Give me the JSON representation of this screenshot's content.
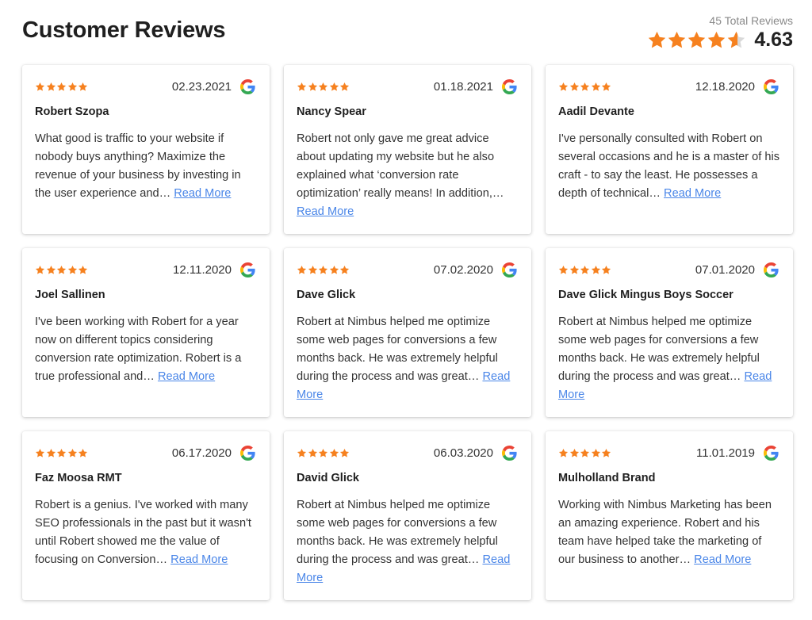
{
  "header": {
    "title": "Customer Reviews",
    "total_reviews": "45 Total Reviews",
    "rating": "4.63"
  },
  "colors": {
    "star": "#f6811f",
    "link": "#4a86e8"
  },
  "icons": {
    "star": "star-icon",
    "google": "google-icon"
  },
  "reviews": [
    {
      "date": "02.23.2021",
      "name": "Robert Szopa",
      "stars": 5,
      "text": "What good is traffic to your website if nobody buys anything? Maximize the revenue of your business by investing in the user experience and…",
      "read_more": "Read More"
    },
    {
      "date": "01.18.2021",
      "name": "Nancy Spear",
      "stars": 5,
      "text": "Robert not only gave me great advice about updating my website but he also explained what ‘conversion rate optimization’ really means! In addition,…",
      "read_more": "Read More"
    },
    {
      "date": "12.18.2020",
      "name": "Aadil Devante",
      "stars": 5,
      "text": "I've personally consulted with Robert on several occasions and he is a master of his craft - to say the least. He possesses a depth of technical…",
      "read_more": "Read More"
    },
    {
      "date": "12.11.2020",
      "name": "Joel Sallinen",
      "stars": 5,
      "text": "I've been working with Robert for a year now on different topics considering conversion rate optimization. Robert is a true professional and…",
      "read_more": "Read More"
    },
    {
      "date": "07.02.2020",
      "name": "Dave Glick",
      "stars": 5,
      "text": "Robert at Nimbus helped me optimize some web pages for conversions a few months back. He was extremely helpful during the process and was great…",
      "read_more": "Read More"
    },
    {
      "date": "07.01.2020",
      "name": "Dave Glick Mingus Boys Soccer",
      "stars": 5,
      "text": "Robert at Nimbus helped me optimize some web pages for conversions a few months back. He was extremely helpful during the process and was great…",
      "read_more": "Read More"
    },
    {
      "date": "06.17.2020",
      "name": "Faz Moosa RMT",
      "stars": 5,
      "text": "Robert is a genius. I've worked with many SEO professionals in the past but it wasn't until Robert showed me the value of focusing on Conversion…",
      "read_more": "Read More"
    },
    {
      "date": "06.03.2020",
      "name": "David Glick",
      "stars": 5,
      "text": "Robert at Nimbus helped me optimize some web pages for conversions a few months back. He was extremely helpful during the process and was great…",
      "read_more": "Read More"
    },
    {
      "date": "11.01.2019",
      "name": "Mulholland Brand",
      "stars": 5,
      "text": "Working with Nimbus Marketing has been an amazing experience. Robert and his team have helped take the marketing of our business to another…",
      "read_more": "Read More"
    }
  ]
}
